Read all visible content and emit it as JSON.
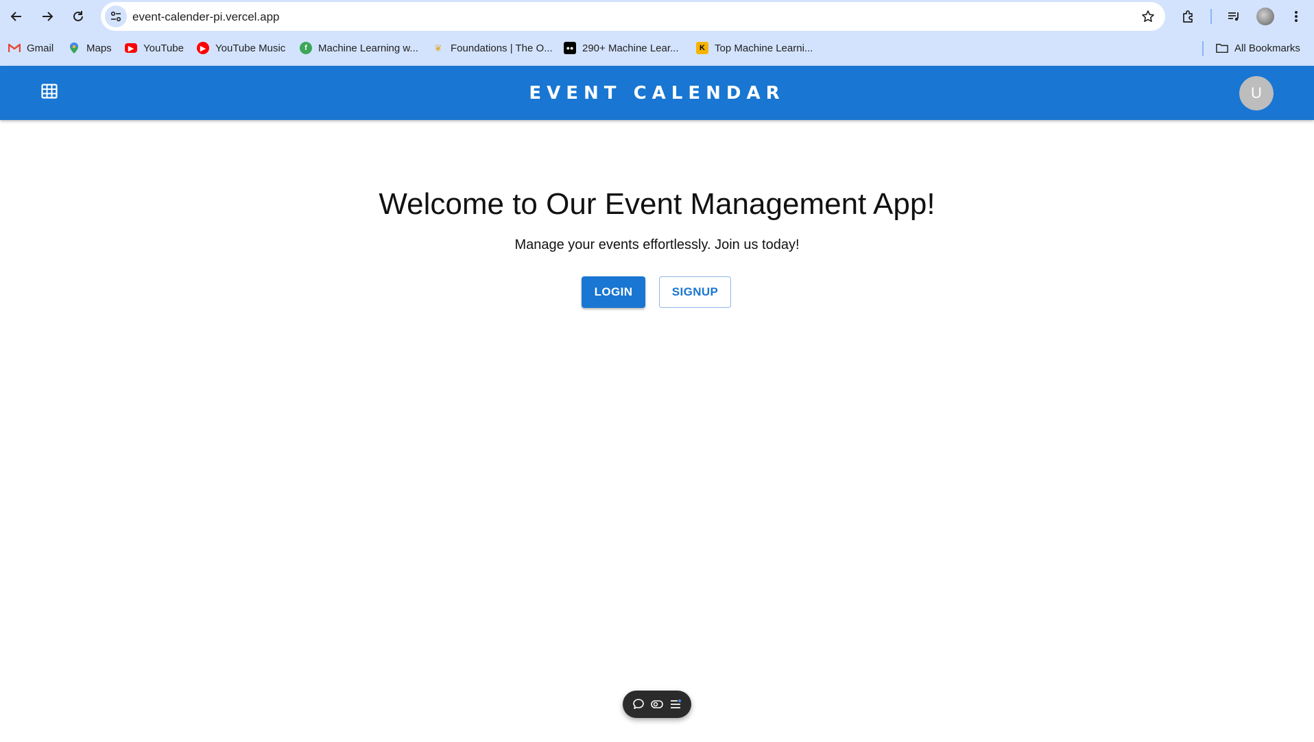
{
  "browser": {
    "url": "event-calender-pi.vercel.app",
    "bookmarks": [
      {
        "label": "Gmail",
        "icon": "gmail-icon"
      },
      {
        "label": "Maps",
        "icon": "maps-icon"
      },
      {
        "label": "YouTube",
        "icon": "youtube-icon"
      },
      {
        "label": "YouTube Music",
        "icon": "youtube-music-icon"
      },
      {
        "label": "Machine Learning w...",
        "icon": "ml-site-icon"
      },
      {
        "label": "Foundations | The O...",
        "icon": "foundations-icon"
      },
      {
        "label": "290+ Machine Lear...",
        "icon": "medium-icon"
      },
      {
        "label": "Top Machine Learni...",
        "icon": "kdnuggets-icon"
      }
    ],
    "all_bookmarks": "All Bookmarks"
  },
  "appbar": {
    "title": "EVENT CALENDAR",
    "avatar_initial": "U",
    "brand_color": "#1976d2"
  },
  "hero": {
    "title": "Welcome to Our Event Management App!",
    "subtitle": "Manage your events effortlessly. Join us today!",
    "login_label": "LOGIN",
    "signup_label": "SIGNUP"
  }
}
